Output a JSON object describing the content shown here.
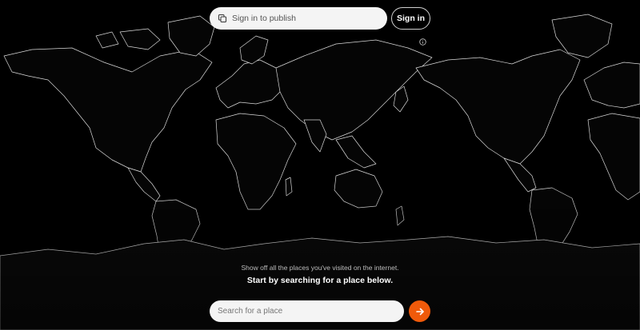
{
  "header": {
    "publish_placeholder": "Sign in to publish",
    "signin_label": "Sign in"
  },
  "tagline": {
    "subtitle": "Show off all the places you've visited on the internet.",
    "title": "Start by searching for a place below."
  },
  "search": {
    "placeholder": "Search for a place"
  },
  "colors": {
    "background": "#000000",
    "land_outline": "#d9d9d9",
    "accent": "#f05a0a",
    "pill": "#f4f4f4"
  },
  "icons": {
    "publish": "copy-icon",
    "info": "info-icon",
    "go": "arrow-right-icon"
  }
}
